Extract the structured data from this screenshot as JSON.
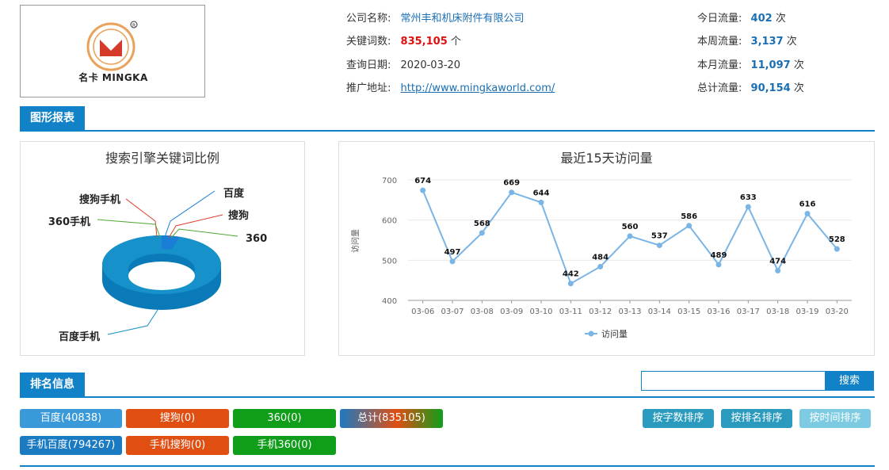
{
  "logo": {
    "text": "名卡 MINGKA"
  },
  "info": {
    "company_label": "公司名称:",
    "company_value": "常州丰和机床附件有限公司",
    "keywords_label": "关键词数:",
    "keywords_value": "835,105",
    "keywords_unit": "个",
    "date_label": "查询日期:",
    "date_value": "2020-03-20",
    "url_label": "推广地址:",
    "url_value": "http://www.mingkaworld.com/"
  },
  "traffic": {
    "today_label": "今日流量:",
    "today_value": "402",
    "today_unit": "次",
    "week_label": "本周流量:",
    "week_value": "3,137",
    "week_unit": "次",
    "month_label": "本月流量:",
    "month_value": "11,097",
    "month_unit": "次",
    "total_label": "总计流量:",
    "total_value": "90,154",
    "total_unit": "次"
  },
  "sections": {
    "charts_tab": "图形报表",
    "ranking_tab": "排名信息"
  },
  "chart_data": [
    {
      "type": "pie",
      "title": "搜索引擎关键词比例",
      "categories": [
        "百度",
        "搜狗",
        "360",
        "百度手机",
        "搜狗手机",
        "360手机"
      ],
      "values": [
        40838,
        0,
        0,
        794267,
        0,
        0
      ],
      "colors": [
        "#1a7dd6",
        "#e03c2c",
        "#4ca830",
        "#1691c9",
        "#e03c2c",
        "#4ca830"
      ]
    },
    {
      "type": "line",
      "title": "最近15天访问量",
      "ylabel": "访问量",
      "ylim": [
        400,
        700
      ],
      "yticks": [
        400,
        500,
        600,
        700
      ],
      "categories": [
        "03-06",
        "03-07",
        "03-08",
        "03-09",
        "03-10",
        "03-11",
        "03-12",
        "03-13",
        "03-14",
        "03-15",
        "03-16",
        "03-17",
        "03-18",
        "03-19",
        "03-20"
      ],
      "series": [
        {
          "name": "访问量",
          "values": [
            674,
            497,
            568,
            669,
            644,
            442,
            484,
            560,
            537,
            586,
            489,
            633,
            474,
            616,
            528
          ]
        }
      ],
      "color": "#7ab5e6",
      "legend": "bottom-center"
    }
  ],
  "search": {
    "placeholder": "",
    "button_label": "搜索"
  },
  "tags": [
    {
      "label": "百度(40838)",
      "color": "#3a9ad9"
    },
    {
      "label": "搜狗(0)",
      "color": "#e04e12"
    },
    {
      "label": "360(0)",
      "color": "#109e1a"
    },
    {
      "label": "总计(835105)",
      "color": "gradient"
    },
    {
      "label": "手机百度(794267)",
      "color": "#1a7ac2"
    },
    {
      "label": "手机搜狗(0)",
      "color": "#e04e12"
    },
    {
      "label": "手机360(0)",
      "color": "#109e1a"
    }
  ],
  "sort_buttons": {
    "by_chars": "按字数排序",
    "by_rank": "按排名排序",
    "by_time": "按时间排序"
  }
}
